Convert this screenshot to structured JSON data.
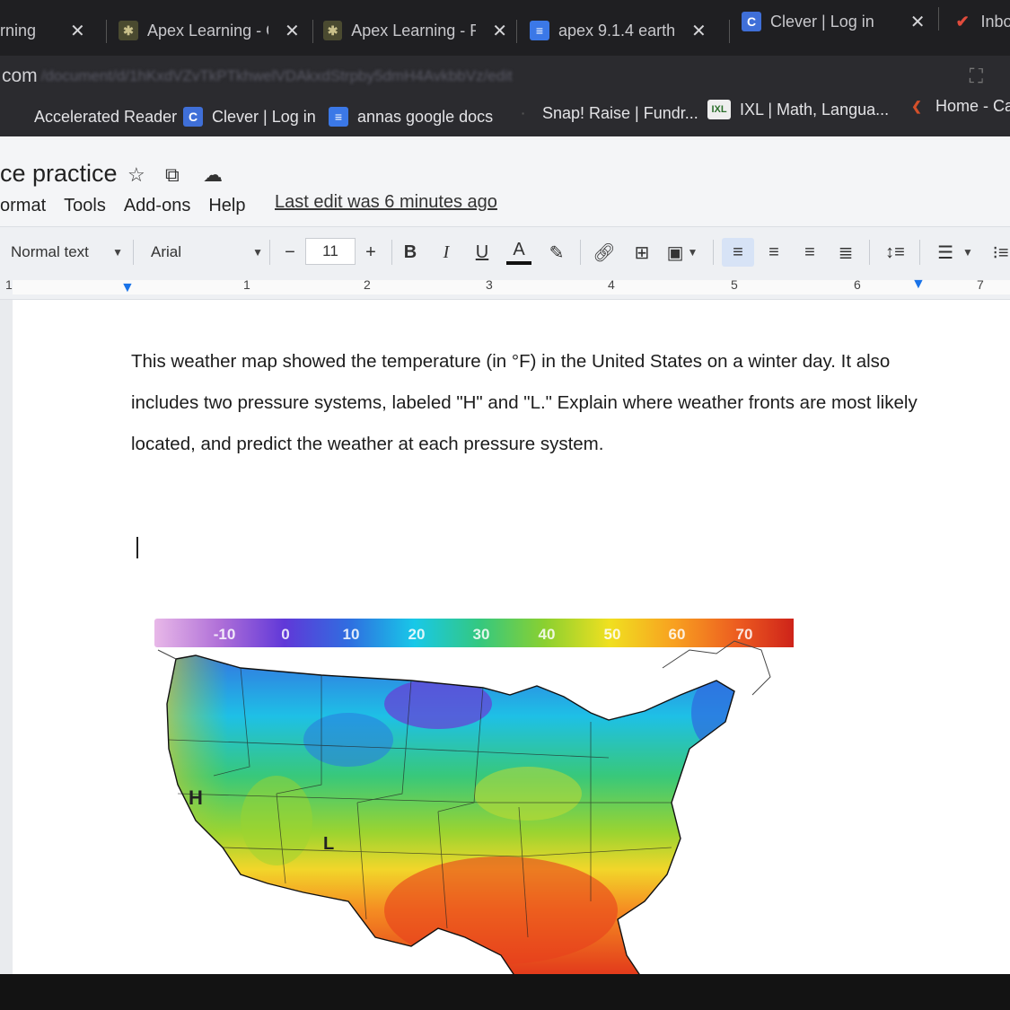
{
  "tabs": [
    {
      "title": "rning",
      "favicon": "apex-icon"
    },
    {
      "title": "Apex Learning - C",
      "favicon": "apex-icon"
    },
    {
      "title": "Apex Learning - P",
      "favicon": "apex-icon"
    },
    {
      "title": "apex 9.1.4 earth s",
      "favicon": "docs-icon"
    },
    {
      "title": "Clever | Log in",
      "favicon": "clever-icon"
    },
    {
      "title": "Inbo",
      "favicon": "gmail-icon"
    }
  ],
  "omnibox": {
    "url": "com",
    "url_blurred": "/document/d/1hKxdVZvTkPTkhwelVDAkxdStrpby5dmH4AvkbbVz/edit"
  },
  "bookmarks": [
    {
      "label": "Accelerated Reader"
    },
    {
      "label": "Clever | Log in"
    },
    {
      "label": "annas google docs"
    },
    {
      "label": "Snap! Raise | Fundr..."
    },
    {
      "label": "IXL | Math, Langua..."
    },
    {
      "label": "Home - Ca"
    }
  ],
  "doc": {
    "title": "ce practice",
    "menu": [
      "ormat",
      "Tools",
      "Add-ons",
      "Help"
    ],
    "last_edit": "Last edit was 6 minutes ago"
  },
  "toolbar": {
    "style": "Normal text",
    "font": "Arial",
    "font_size": "11",
    "minus": "−",
    "plus": "+",
    "bold": "B",
    "italic": "I",
    "underline": "U",
    "text_color": "A"
  },
  "ruler": {
    "numbers": [
      "1",
      "1",
      "2",
      "3",
      "4",
      "5",
      "6",
      "7"
    ]
  },
  "body": {
    "question": "This weather map showed the temperature (in °F) in the United States on a winter day. It also includes two pressure systems, labeled \"H\" and \"L.\" Explain where weather fronts are most likely located, and predict the weather at each pressure system."
  },
  "map": {
    "scale_labels": [
      "-10",
      "0",
      "10",
      "20",
      "30",
      "40",
      "50",
      "60",
      "70"
    ],
    "high_label": "H",
    "low_label": "L"
  },
  "colors": {
    "tab_bg": "#1f1f22",
    "toolbar_bg": "#eef0f3",
    "accent": "#1a73e8"
  }
}
